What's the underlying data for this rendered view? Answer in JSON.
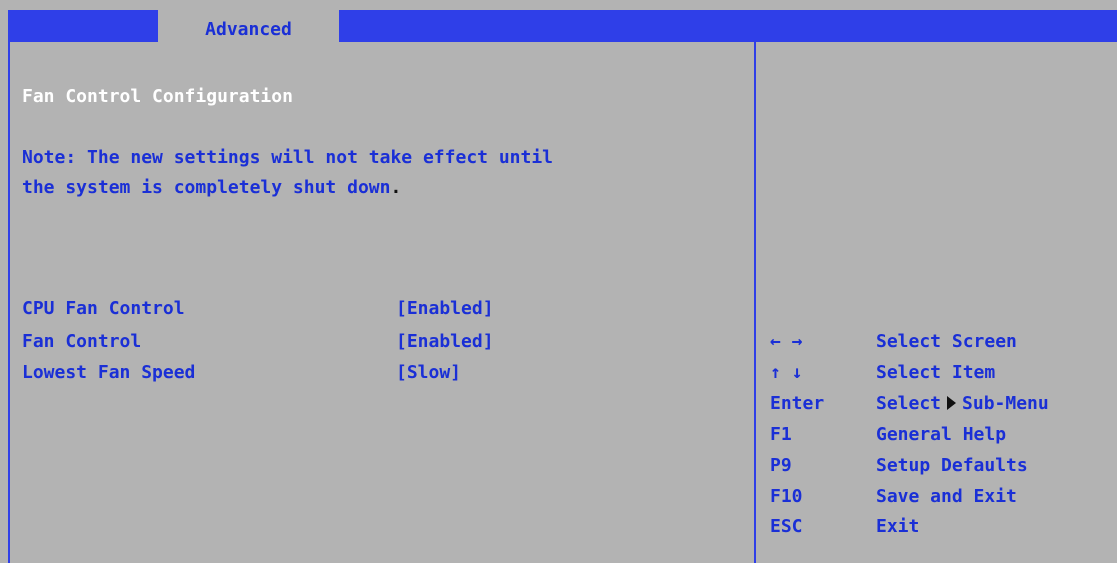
{
  "header": {
    "active_tab": "Advanced"
  },
  "main": {
    "section_title": "Fan Control Configuration",
    "note_line1": "Note: The new settings will not take effect until",
    "note_line2": "the system is completely shut down",
    "note_period": ".",
    "settings": [
      {
        "label": "CPU Fan Control",
        "value": "[Enabled]"
      },
      {
        "label": "Fan Control",
        "value": "[Enabled]"
      },
      {
        "label": "Lowest Fan Speed",
        "value": "[Slow]"
      }
    ]
  },
  "help": [
    {
      "key": "← →",
      "desc": "Select Screen"
    },
    {
      "key": "↑ ↓",
      "desc": "Select Item"
    },
    {
      "key": "Enter",
      "desc_pre": "Select",
      "desc_post": "Sub-Menu",
      "icon": "right-triangle-icon"
    },
    {
      "key": "F1",
      "desc": "General Help"
    },
    {
      "key": "P9",
      "desc": "Setup Defaults"
    },
    {
      "key": "F10",
      "desc": "Save and Exit"
    },
    {
      "key": "ESC",
      "desc": "Exit"
    }
  ],
  "colors": {
    "background": "#b3b3b3",
    "accent_blue": "#2f3fe8",
    "text_blue": "#1a2fd6",
    "text_white": "#ffffff"
  }
}
